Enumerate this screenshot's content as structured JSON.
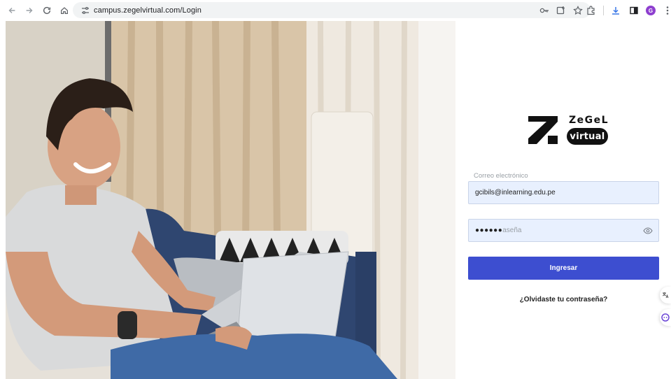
{
  "browser": {
    "url": "campus.zegelvirtual.com/Login",
    "profile_initial": "G",
    "icons": [
      "back-icon",
      "forward-icon",
      "reload-icon",
      "home-icon",
      "tune-icon",
      "password-key-icon",
      "install-app-icon",
      "bookmark-star-icon",
      "extensions-icon",
      "download-icon",
      "side-panel-icon",
      "menu-kebab-icon"
    ]
  },
  "brand": {
    "name_top": "ZeGeL",
    "name_pill": "virtual"
  },
  "login": {
    "email_label": "Correo electrónico",
    "email_value": "gcibils@inlearning.edu.pe",
    "password_masked": "●●●●●●",
    "password_placeholder_tail": "aseña",
    "submit_label": "Ingresar",
    "forgot_label": "¿Olvidaste tu contraseña?"
  },
  "colors": {
    "primary_button": "#3d4ed0",
    "autofill_bg": "#e8f0fe",
    "profile_avatar": "#8e3fcf"
  }
}
